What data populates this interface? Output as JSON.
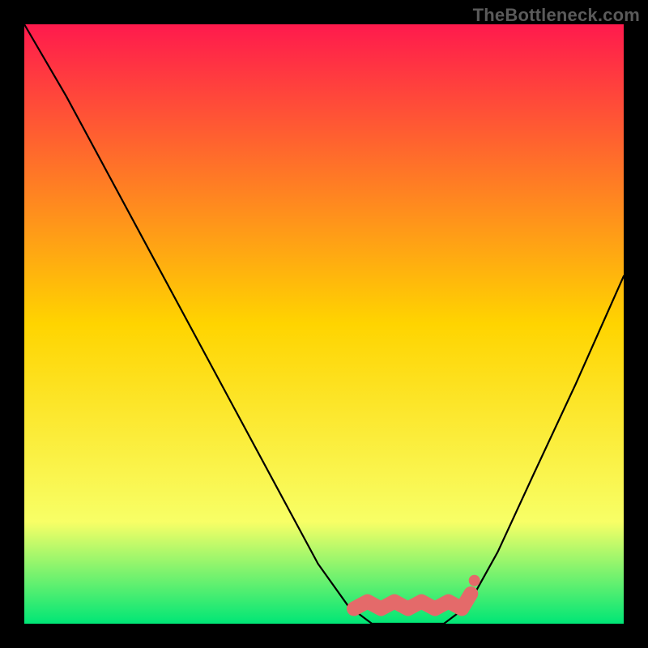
{
  "watermark": "TheBottleneck.com",
  "colors": {
    "black": "#000000",
    "curve": "#000000",
    "blob": "#e46a6a",
    "grad_top": "#ff1a4d",
    "grad_mid": "#ffd400",
    "grad_low": "#f8ff66",
    "grad_bottom": "#00e676"
  },
  "layout": {
    "inner_x": 30,
    "inner_y": 30,
    "inner_w": 740,
    "inner_h": 740
  },
  "chart_data": {
    "type": "line",
    "title": "",
    "xlabel": "",
    "ylabel": "",
    "ylim": [
      0,
      100
    ],
    "series": [
      {
        "name": "bottleneck-curve",
        "x": [
          0.0,
          0.07,
          0.14,
          0.21,
          0.28,
          0.35,
          0.42,
          0.49,
          0.54,
          0.58,
          0.62,
          0.66,
          0.7,
          0.74,
          0.79,
          0.85,
          0.92,
          1.0
        ],
        "values": [
          100,
          88,
          75,
          62,
          49,
          36,
          23,
          10,
          3,
          0,
          0,
          0,
          0,
          3,
          12,
          25,
          40,
          58
        ]
      }
    ],
    "markers": [
      {
        "name": "optimum-blob-start",
        "x": 0.55,
        "y": 2.5
      },
      {
        "name": "optimum-blob-end",
        "x": 0.73,
        "y": 2.5
      },
      {
        "name": "optimum-blob-tip",
        "x": 0.745,
        "y": 5.0
      }
    ]
  }
}
